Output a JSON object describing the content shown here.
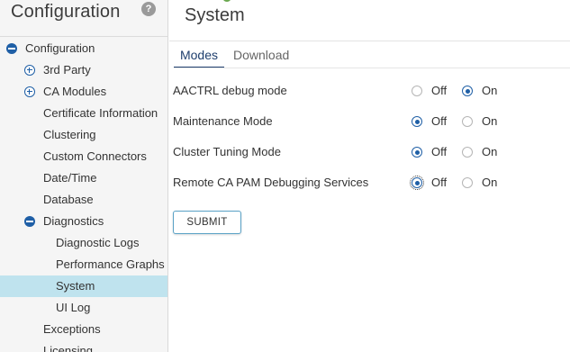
{
  "sidebar": {
    "title": "Configuration",
    "help_glyph": "?",
    "items": [
      {
        "label": "Configuration",
        "icon": "minus-circle-icon",
        "level": 0
      },
      {
        "label": "3rd Party",
        "icon": "plus-circle-icon",
        "level": 1
      },
      {
        "label": "CA Modules",
        "icon": "plus-circle-icon",
        "level": 1
      },
      {
        "label": "Certificate Information",
        "icon": "",
        "level": 1
      },
      {
        "label": "Clustering",
        "icon": "",
        "level": 1
      },
      {
        "label": "Custom Connectors",
        "icon": "",
        "level": 1
      },
      {
        "label": "Date/Time",
        "icon": "",
        "level": 1
      },
      {
        "label": "Database",
        "icon": "",
        "level": 1
      },
      {
        "label": "Diagnostics",
        "icon": "minus-circle-icon",
        "level": 1
      },
      {
        "label": "Diagnostic Logs",
        "icon": "",
        "level": 2
      },
      {
        "label": "Performance Graphs",
        "icon": "",
        "level": 2
      },
      {
        "label": "System",
        "icon": "",
        "level": 2,
        "selected": true
      },
      {
        "label": "UI Log",
        "icon": "",
        "level": 2
      },
      {
        "label": "Exceptions",
        "icon": "",
        "level": 1
      },
      {
        "label": "Licensing",
        "icon": "",
        "level": 1
      }
    ]
  },
  "main": {
    "title": "System",
    "tabs": [
      {
        "label": "Modes",
        "active": true
      },
      {
        "label": "Download",
        "active": false
      }
    ],
    "settings": [
      {
        "label": "AACTRL debug mode",
        "off_label": "Off",
        "on_label": "On",
        "value": "On"
      },
      {
        "label": "Maintenance Mode",
        "off_label": "Off",
        "on_label": "On",
        "value": "Off"
      },
      {
        "label": "Cluster Tuning Mode",
        "off_label": "Off",
        "on_label": "On",
        "value": "Off"
      },
      {
        "label": "Remote CA PAM Debugging Services",
        "off_label": "Off",
        "on_label": "On",
        "value": "Off"
      }
    ],
    "submit_label": "SUBMIT"
  },
  "colors": {
    "accent": "#1f5fa6",
    "selected_row": "#bfe3ee",
    "sidebar_bg": "#f5f5f5",
    "button_border": "#5aa2c6"
  }
}
